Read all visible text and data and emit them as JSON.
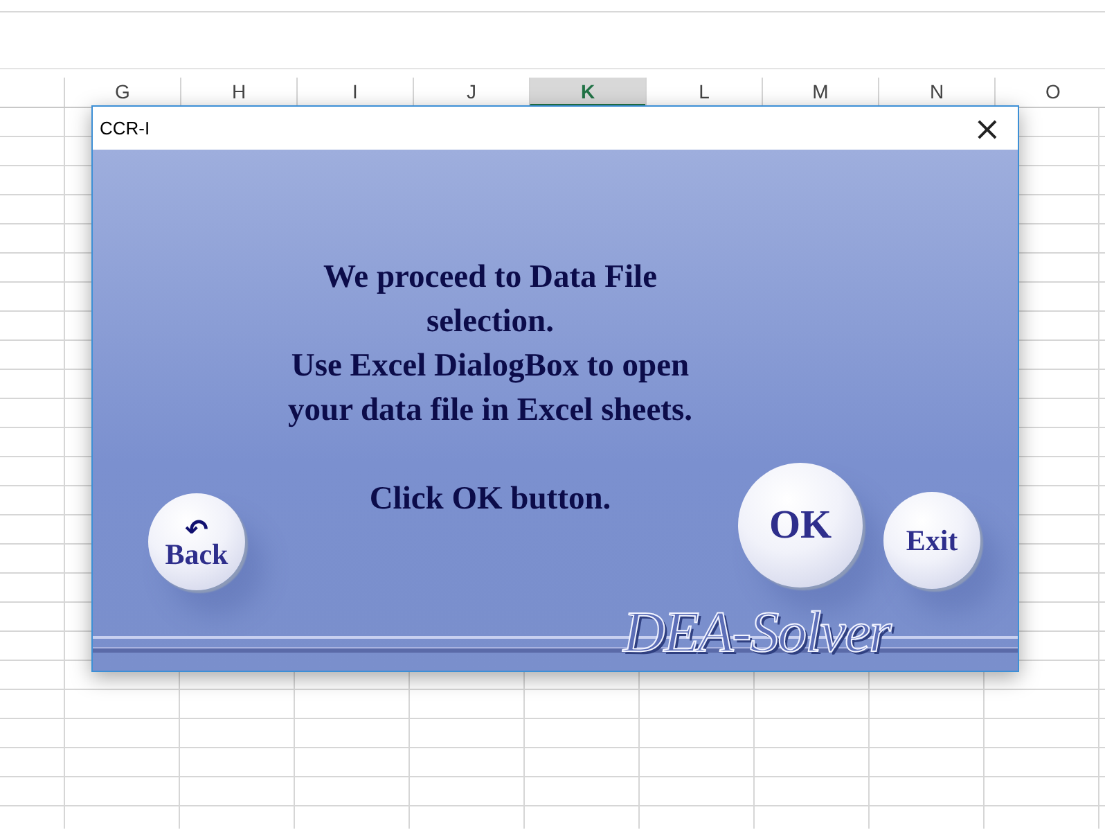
{
  "sheet": {
    "columns": [
      {
        "label": "G",
        "selected": false
      },
      {
        "label": "H",
        "selected": false
      },
      {
        "label": "I",
        "selected": false
      },
      {
        "label": "J",
        "selected": false
      },
      {
        "label": "K",
        "selected": true
      },
      {
        "label": "L",
        "selected": false
      },
      {
        "label": "M",
        "selected": false
      },
      {
        "label": "N",
        "selected": false
      },
      {
        "label": "O",
        "selected": false
      }
    ]
  },
  "dialog": {
    "title": "CCR-I",
    "close": "×",
    "message_lines": [
      "We proceed to Data File",
      "selection.",
      "Use Excel DialogBox to open",
      "your data file in Excel sheets."
    ],
    "instruction": "Click OK button.",
    "back_button": {
      "icon": "↶",
      "label": "Back"
    },
    "ok_button": "OK",
    "exit_button": "Exit",
    "logo": "DEA-Solver"
  }
}
